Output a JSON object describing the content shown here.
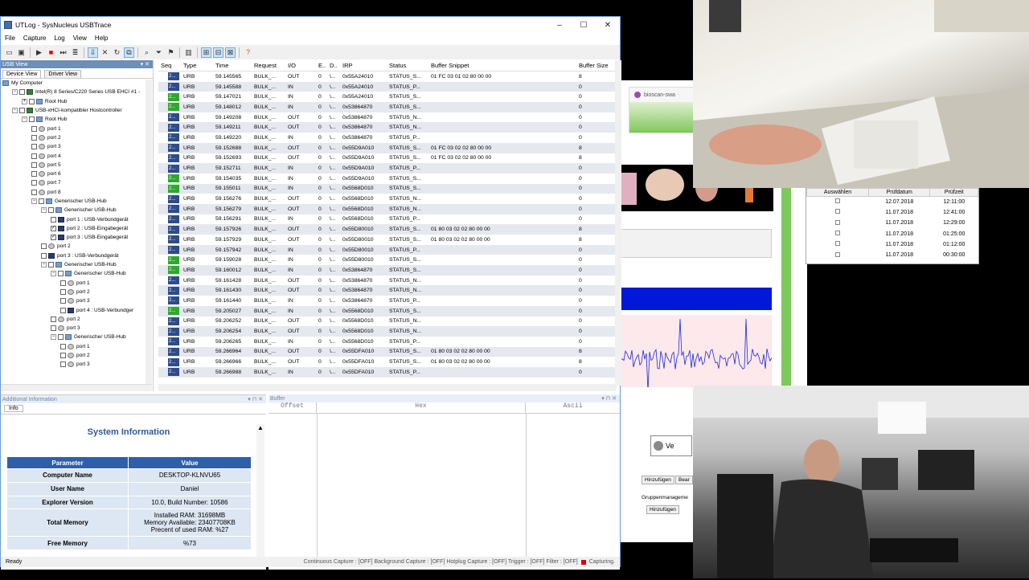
{
  "window": {
    "title": "UTLog - SysNucleus USBTrace",
    "controls": [
      "–",
      "☐",
      "✕"
    ]
  },
  "menu": [
    "File",
    "Capture",
    "Log",
    "View",
    "Help"
  ],
  "usb_view": {
    "header": "USB View",
    "tabs": [
      "Device View",
      "Driver View"
    ],
    "tree": [
      {
        "label": "My Computer",
        "level": 0,
        "icon": "computer"
      },
      {
        "label": "Intel(R) 8 Series/C220 Series USB EHCI #1 -",
        "level": 1,
        "icon": "ctrl",
        "exp": "−",
        "chk": "sq"
      },
      {
        "label": "Root Hub",
        "level": 2,
        "icon": "hub",
        "exp": "+",
        "chk": "sq"
      },
      {
        "label": "USB-xHCI-kompatibler Hostcontroller",
        "level": 1,
        "icon": "ctrl",
        "exp": "−",
        "chk": "sq"
      },
      {
        "label": "Root Hub",
        "level": 2,
        "icon": "hub",
        "exp": "−",
        "chk": "sq"
      },
      {
        "label": "port 1",
        "level": 3,
        "icon": "port",
        "chk": "sq"
      },
      {
        "label": "port 2",
        "level": 3,
        "icon": "port",
        "chk": "sq"
      },
      {
        "label": "port 3",
        "level": 3,
        "icon": "port",
        "chk": "sq"
      },
      {
        "label": "port 4",
        "level": 3,
        "icon": "port",
        "chk": "sq"
      },
      {
        "label": "port 5",
        "level": 3,
        "icon": "port",
        "chk": "sq"
      },
      {
        "label": "port 6",
        "level": 3,
        "icon": "port",
        "chk": "sq"
      },
      {
        "label": "port 7",
        "level": 3,
        "icon": "port",
        "chk": "sq"
      },
      {
        "label": "port 8",
        "level": 3,
        "icon": "port",
        "chk": "sq"
      },
      {
        "label": "Generischer USB-Hub",
        "level": 3,
        "icon": "hub",
        "exp": "−",
        "chk": "sq"
      },
      {
        "label": "Generischer USB-Hub",
        "level": 4,
        "icon": "hub",
        "exp": "−",
        "chk": "sq"
      },
      {
        "label": "port 1 : USB-Verbundgerät",
        "level": 5,
        "icon": "dev",
        "chk": "sq"
      },
      {
        "label": "port 2 : USB-Eingabegerät",
        "level": 5,
        "icon": "dev",
        "chk": "✓"
      },
      {
        "label": "port 3 : USB-Eingabegerät",
        "level": 5,
        "icon": "dev",
        "chk": "✓"
      },
      {
        "label": "port 2",
        "level": 4,
        "icon": "port",
        "chk": "sq"
      },
      {
        "label": "port 3 : USB-Verbundgerät",
        "level": 4,
        "icon": "dev",
        "chk": "sq"
      },
      {
        "label": "Generischer USB-Hub",
        "level": 4,
        "icon": "hub",
        "exp": "−",
        "chk": "sq"
      },
      {
        "label": "Generischer USB-Hub",
        "level": 5,
        "icon": "hub",
        "exp": "−",
        "chk": "sq"
      },
      {
        "label": "port 1",
        "level": 6,
        "icon": "port",
        "chk": "sq"
      },
      {
        "label": "port 2",
        "level": 6,
        "icon": "port",
        "chk": "sq"
      },
      {
        "label": "port 3",
        "level": 6,
        "icon": "port",
        "chk": "sq"
      },
      {
        "label": "port 4 : USB-Verbundger",
        "level": 6,
        "icon": "dev",
        "chk": "sq"
      },
      {
        "label": "port 2",
        "level": 5,
        "icon": "port",
        "chk": "sq"
      },
      {
        "label": "port 3",
        "level": 5,
        "icon": "port",
        "chk": "sq"
      },
      {
        "label": "Generischer USB-Hub",
        "level": 5,
        "icon": "hub",
        "exp": "−",
        "chk": "sq"
      },
      {
        "label": "port 1",
        "level": 6,
        "icon": "port",
        "chk": "sq"
      },
      {
        "label": "port 2",
        "level": 6,
        "icon": "port",
        "chk": "sq"
      },
      {
        "label": "port 3",
        "level": 6,
        "icon": "port",
        "chk": "sq"
      }
    ]
  },
  "grid": {
    "columns": [
      "Seq",
      "Type",
      "Time",
      "Request",
      "I/O",
      "E..",
      "D..",
      "IRP",
      "Status",
      "Buffer Snippet",
      "Buffer Size"
    ],
    "rows": [
      [
        "2...",
        "URB",
        "59.145565",
        "BULK_...",
        "OUT",
        "0",
        "\\...",
        "0x55A24010",
        "STATUS_S...",
        "01 FC 03 01 02 80 00 00",
        "8",
        "b"
      ],
      [
        "2...",
        "URB",
        "59.145588",
        "BULK_...",
        "IN",
        "0",
        "\\...",
        "0x55A24010",
        "STATUS_P...",
        "",
        "0",
        "b"
      ],
      [
        "2...",
        "URB",
        "59.147021",
        "BULK_...",
        "IN",
        "0",
        "\\...",
        "0x55A24010",
        "STATUS_S...",
        "",
        "0",
        "g"
      ],
      [
        "2...",
        "URB",
        "59.148012",
        "BULK_...",
        "IN",
        "0",
        "\\...",
        "0x53864870",
        "STATUS_S...",
        "",
        "0",
        "g"
      ],
      [
        "2...",
        "URB",
        "59.149208",
        "BULK_...",
        "OUT",
        "0",
        "\\...",
        "0x53864870",
        "STATUS_N...",
        "",
        "0",
        "b"
      ],
      [
        "2...",
        "URB",
        "59.149211",
        "BULK_...",
        "OUT",
        "0",
        "\\...",
        "0x53864870",
        "STATUS_N...",
        "",
        "0",
        "b"
      ],
      [
        "2...",
        "URB",
        "59.149220",
        "BULK_...",
        "IN",
        "0",
        "\\...",
        "0x53864870",
        "STATUS_P...",
        "",
        "0",
        "b"
      ],
      [
        "2...",
        "URB",
        "59.152688",
        "BULK_...",
        "OUT",
        "0",
        "\\...",
        "0x55D9A010",
        "STATUS_S...",
        "01 FC 03 02 02 80 00 00",
        "8",
        "b"
      ],
      [
        "2...",
        "URB",
        "59.152693",
        "BULK_...",
        "OUT",
        "0",
        "\\...",
        "0x55D9A010",
        "STATUS_S...",
        "01 FC 03 02 02 80 00 00",
        "8",
        "b"
      ],
      [
        "2...",
        "URB",
        "59.152711",
        "BULK_...",
        "IN",
        "0",
        "\\...",
        "0x55D9A010",
        "STATUS_P...",
        "",
        "0",
        "b"
      ],
      [
        "2...",
        "URB",
        "59.154035",
        "BULK_...",
        "IN",
        "0",
        "\\...",
        "0x55D9A010",
        "STATUS_S...",
        "",
        "0",
        "g"
      ],
      [
        "2...",
        "URB",
        "59.155011",
        "BULK_...",
        "IN",
        "0",
        "\\...",
        "0x5568D010",
        "STATUS_S...",
        "",
        "0",
        "g"
      ],
      [
        "2...",
        "URB",
        "59.156276",
        "BULK_...",
        "OUT",
        "0",
        "\\...",
        "0x5568D010",
        "STATUS_N...",
        "",
        "0",
        "b"
      ],
      [
        "2...",
        "URB",
        "59.156279",
        "BULK_...",
        "OUT",
        "0",
        "\\...",
        "0x5568D010",
        "STATUS_N...",
        "",
        "0",
        "b"
      ],
      [
        "2...",
        "URB",
        "59.156291",
        "BULK_...",
        "IN",
        "0",
        "\\...",
        "0x5568D010",
        "STATUS_P...",
        "",
        "0",
        "b"
      ],
      [
        "2...",
        "URB",
        "59.157926",
        "BULK_...",
        "OUT",
        "0",
        "\\...",
        "0x55D80010",
        "STATUS_S...",
        "01 80 03 02 02 80 00 00",
        "8",
        "b"
      ],
      [
        "2...",
        "URB",
        "59.157929",
        "BULK_...",
        "OUT",
        "0",
        "\\...",
        "0x55D80010",
        "STATUS_S...",
        "01 80 03 02 02 80 00 00",
        "8",
        "b"
      ],
      [
        "2...",
        "URB",
        "59.157942",
        "BULK_...",
        "IN",
        "0",
        "\\...",
        "0x55D80010",
        "STATUS_P...",
        "",
        "0",
        "b"
      ],
      [
        "2...",
        "URB",
        "59.159028",
        "BULK_...",
        "IN",
        "0",
        "\\...",
        "0x55D80010",
        "STATUS_S...",
        "",
        "0",
        "g"
      ],
      [
        "2...",
        "URB",
        "59.160012",
        "BULK_...",
        "IN",
        "0",
        "\\...",
        "0x53864870",
        "STATUS_S...",
        "",
        "0",
        "g"
      ],
      [
        "2...",
        "URB",
        "59.161428",
        "BULK_...",
        "OUT",
        "0",
        "\\...",
        "0x53864870",
        "STATUS_N...",
        "",
        "0",
        "b"
      ],
      [
        "2...",
        "URB",
        "59.161430",
        "BULK_...",
        "OUT",
        "0",
        "\\...",
        "0x53864870",
        "STATUS_N...",
        "",
        "0",
        "b"
      ],
      [
        "2...",
        "URB",
        "59.161440",
        "BULK_...",
        "IN",
        "0",
        "\\...",
        "0x53864870",
        "STATUS_P...",
        "",
        "0",
        "b"
      ],
      [
        "2...",
        "URB",
        "59.205027",
        "BULK_...",
        "IN",
        "0",
        "\\...",
        "0x5568D010",
        "STATUS_S...",
        "",
        "0",
        "g"
      ],
      [
        "2...",
        "URB",
        "59.206252",
        "BULK_...",
        "OUT",
        "0",
        "\\...",
        "0x5568D010",
        "STATUS_N...",
        "",
        "0",
        "b"
      ],
      [
        "2...",
        "URB",
        "59.206254",
        "BULK_...",
        "OUT",
        "0",
        "\\...",
        "0x5568D010",
        "STATUS_N...",
        "",
        "0",
        "b"
      ],
      [
        "2...",
        "URB",
        "59.206265",
        "BULK_...",
        "IN",
        "0",
        "\\...",
        "0x5568D010",
        "STATUS_P...",
        "",
        "0",
        "b"
      ],
      [
        "2...",
        "URB",
        "59.266964",
        "BULK_...",
        "OUT",
        "0",
        "\\...",
        "0x55DFA010",
        "STATUS_S...",
        "01 80 03 02 02 80 00 00",
        "8",
        "b"
      ],
      [
        "2...",
        "URB",
        "59.266966",
        "BULK_...",
        "OUT",
        "0",
        "\\...",
        "0x55DFA010",
        "STATUS_S...",
        "01 80 03 02 02 80 00 00",
        "8",
        "b"
      ],
      [
        "2...",
        "URB",
        "59.266988",
        "BULK_...",
        "IN",
        "0",
        "\\...",
        "0x55DFA010",
        "STATUS_P...",
        "",
        "0",
        "b"
      ]
    ]
  },
  "info_pane": {
    "header": "Additional Information",
    "tab": "Info",
    "title": "System Information",
    "col_param": "Parameter",
    "col_value": "Value",
    "rows": [
      {
        "k": "Computer Name",
        "v": "DESKTOP-KLNVU65"
      },
      {
        "k": "User Name",
        "v": "Daniel"
      },
      {
        "k": "Explorer Version",
        "v": "10.0, Build Number: 10586"
      },
      {
        "k": "Total Memory",
        "v": "Installed RAM: 31698MB\nMemory Available: 23407708KB\nPrecent of used RAM: %27"
      },
      {
        "k": "Free Memory",
        "v": "%73"
      }
    ]
  },
  "buffer_pane": {
    "header": "Buffer",
    "cols": [
      "Offset",
      "Hex",
      "Ascii"
    ]
  },
  "status": {
    "ready": "Ready",
    "capture": "Continuous Capture : [OFF] Background Capture : [OFF] Hotplug Capture : [OFF]  Trigger : [OFF]  Filter : [OFF]",
    "capturing": "Capturing."
  },
  "bioscan": {
    "title": "bioscan-swa"
  },
  "dates_table": {
    "headers": [
      "Auswählen",
      "Prüfdatum",
      "Prüfzeit"
    ],
    "rows": [
      [
        "12.07.2018",
        "12:11:00"
      ],
      [
        "11.07.2018",
        "12:41:00"
      ],
      [
        "11.07.2018",
        "12:29:00"
      ],
      [
        "11.07.2018",
        "01:25:00"
      ],
      [
        "11.07.2018",
        "01:12:00"
      ],
      [
        "11.07.2018",
        "00:30:00"
      ]
    ]
  },
  "side_buttons": {
    "add": "Hinzufügen",
    "edit": "Bear",
    "group": "Gruppenmanageme",
    "add2": "Hinzufügen",
    "ve": "Ve"
  },
  "colors": {
    "accent": "#2e5fa8",
    "seq_blue": "#2e4b8a",
    "seq_green": "#2ea82e",
    "ecg_line": "#1a2ad8"
  }
}
